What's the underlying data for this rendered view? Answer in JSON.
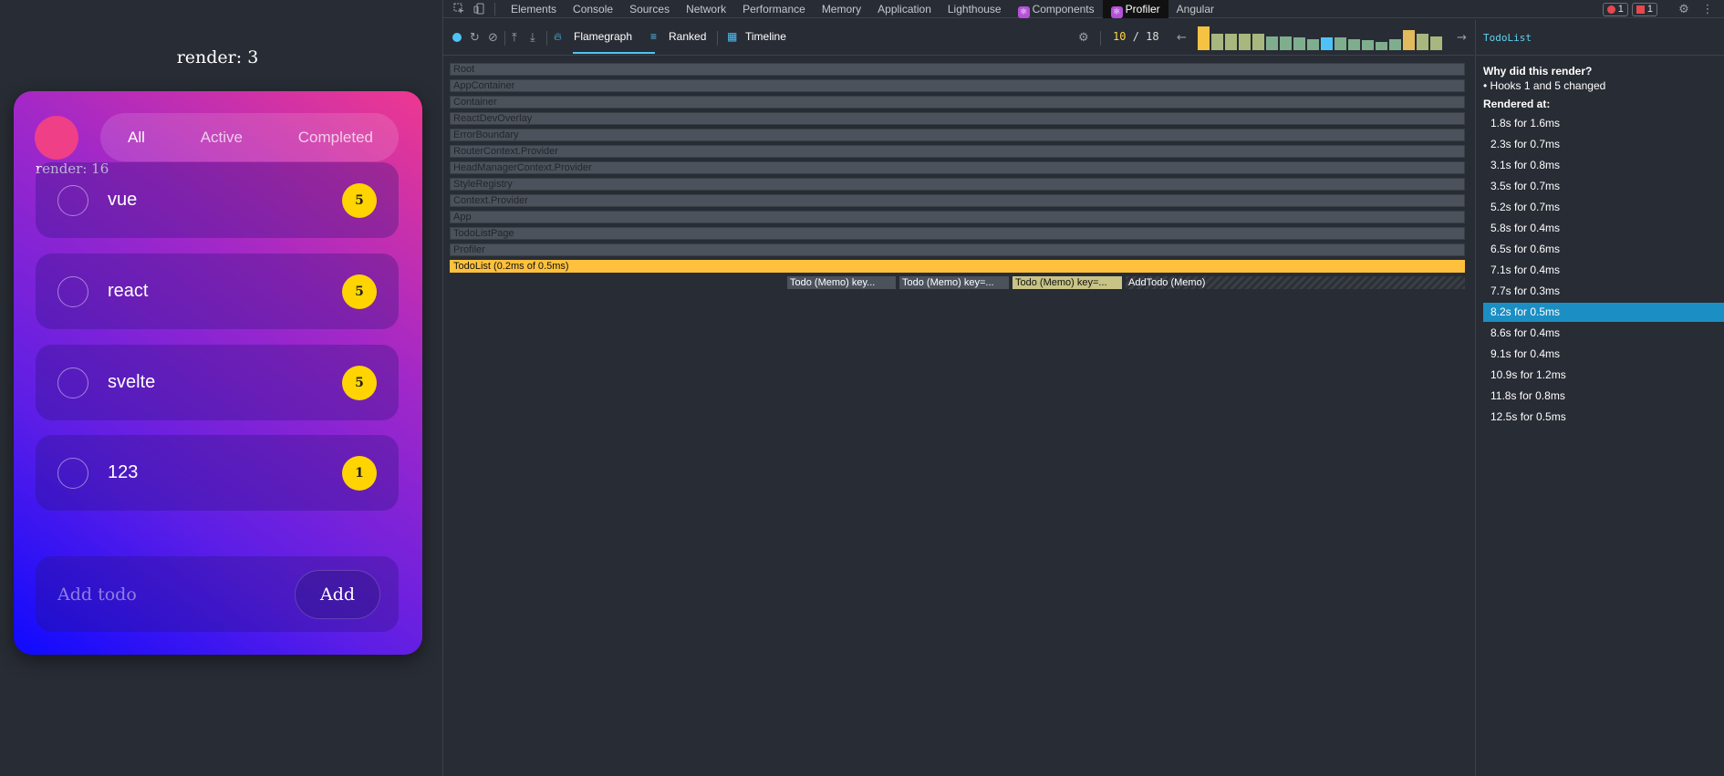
{
  "app": {
    "render_label": "render: 3",
    "card_render_label": "render: 16",
    "filters": [
      "All",
      "Active",
      "Completed"
    ],
    "active_filter": "All",
    "todos": [
      {
        "text": "vue",
        "count": "5"
      },
      {
        "text": "react",
        "count": "5"
      },
      {
        "text": "svelte",
        "count": "5"
      },
      {
        "text": "123",
        "count": "1"
      }
    ],
    "add_placeholder": "Add todo",
    "add_button": "Add",
    "colors": {
      "avatar": "#ef3f86",
      "badge": "#ffd400",
      "gradient_top": "#ee3890",
      "gradient_bottom": "#0f0aff"
    }
  },
  "devtools": {
    "tabs": [
      "Elements",
      "Console",
      "Sources",
      "Network",
      "Performance",
      "Memory",
      "Application",
      "Lighthouse",
      "Components",
      "Profiler",
      "Angular"
    ],
    "active_tab": "Profiler",
    "error_count": "1",
    "warning_count": "1",
    "profiler": {
      "tabs": [
        "Flamegraph",
        "Ranked",
        "Timeline"
      ],
      "active_tab": "Flamegraph",
      "commit_current": "10",
      "commit_total": "18",
      "commit_bars": [
        {
          "h": 0.95,
          "color": "#f5c242"
        },
        {
          "h": 0.65,
          "color": "#a7b77e"
        },
        {
          "h": 0.65,
          "color": "#a7b77e"
        },
        {
          "h": 0.65,
          "color": "#a7b77e"
        },
        {
          "h": 0.65,
          "color": "#a7b77e"
        },
        {
          "h": 0.55,
          "color": "#7fae8e"
        },
        {
          "h": 0.55,
          "color": "#7fae8e"
        },
        {
          "h": 0.5,
          "color": "#7fae8e"
        },
        {
          "h": 0.45,
          "color": "#7fae8e"
        },
        {
          "h": 0.5,
          "color": "#4fc3f7"
        },
        {
          "h": 0.5,
          "color": "#7fae8e"
        },
        {
          "h": 0.45,
          "color": "#7fae8e"
        },
        {
          "h": 0.4,
          "color": "#7fae8e"
        },
        {
          "h": 0.35,
          "color": "#7fae8e"
        },
        {
          "h": 0.45,
          "color": "#7fae8e"
        },
        {
          "h": 0.8,
          "color": "#e2bb5c"
        },
        {
          "h": 0.65,
          "color": "#a7b77e"
        },
        {
          "h": 0.55,
          "color": "#a7b77e"
        }
      ],
      "flame_rows": [
        "Root",
        "AppContainer",
        "Container",
        "ReactDevOverlay",
        "ErrorBoundary",
        "RouterContext.Provider",
        "HeadManagerContext.Provider",
        "StyleRegistry",
        "Context.Provider",
        "App",
        "TodoListPage",
        "Profiler",
        "TodoList (0.2ms of 0.5ms)"
      ],
      "flame_children": [
        {
          "label": "Todo (Memo) key...",
          "color": "#4b525c"
        },
        {
          "label": "Todo (Memo) key=...",
          "color": "#4b525c"
        },
        {
          "label": "Todo (Memo) key=...",
          "color": "#c8c486"
        },
        {
          "label": "AddTodo (Memo)",
          "color": "#3a3f46"
        }
      ]
    },
    "side": {
      "component": "TodoList",
      "why_title": "Why did this render?",
      "why_item": "• Hooks 1 and 5 changed",
      "rendered_title": "Rendered at:",
      "rendered": [
        "1.8s for 1.6ms",
        "2.3s for 0.7ms",
        "3.1s for 0.8ms",
        "3.5s for 0.7ms",
        "5.2s for 0.7ms",
        "5.8s for 0.4ms",
        "6.5s for 0.6ms",
        "7.1s for 0.4ms",
        "7.7s for 0.3ms",
        "8.2s for 0.5ms",
        "8.6s for 0.4ms",
        "9.1s for 0.4ms",
        "10.9s for 1.2ms",
        "11.8s for 0.8ms",
        "12.5s for 0.5ms"
      ],
      "selected_index": 9
    }
  }
}
